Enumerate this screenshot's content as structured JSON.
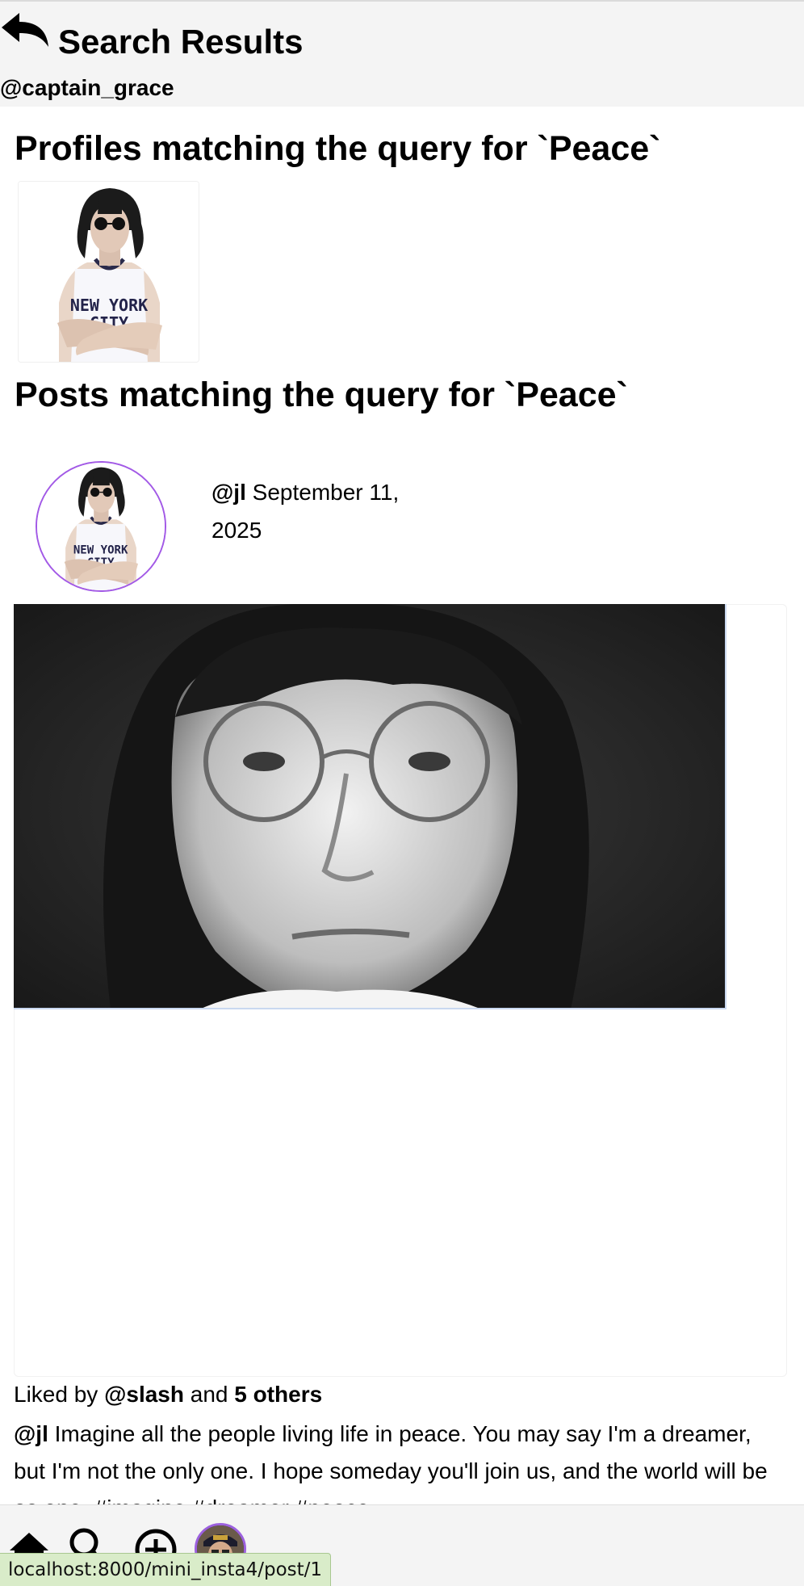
{
  "header": {
    "title": "Search Results",
    "username": "@captain_grace",
    "back_icon": "back-arrow-icon"
  },
  "profiles_section": {
    "heading": "Profiles matching the query for `Peace`"
  },
  "posts_section": {
    "heading": "Posts matching the query for `Peace`"
  },
  "post": {
    "author": "@jl",
    "date": "September 11, 2025",
    "likes": {
      "prefix": "Liked by",
      "user": "@slash",
      "connector": "and",
      "others": "5 others"
    },
    "caption_author": "@jl",
    "caption_text": "Imagine all the people living life in peace. You may say I'm a dreamer, but I'm not the only one. I hope someday you'll join us, and the world will be as one. #imagine #dreamer #peace"
  },
  "bottom_nav": {
    "items": [
      "home-icon",
      "search-icon",
      "create-icon",
      "profile-avatar"
    ]
  },
  "status_bar": {
    "url": "localhost:8000/mini_insta4/post/1"
  },
  "colors": {
    "avatar_ring": "#a259e6",
    "status_bg": "#d9ecc9"
  }
}
